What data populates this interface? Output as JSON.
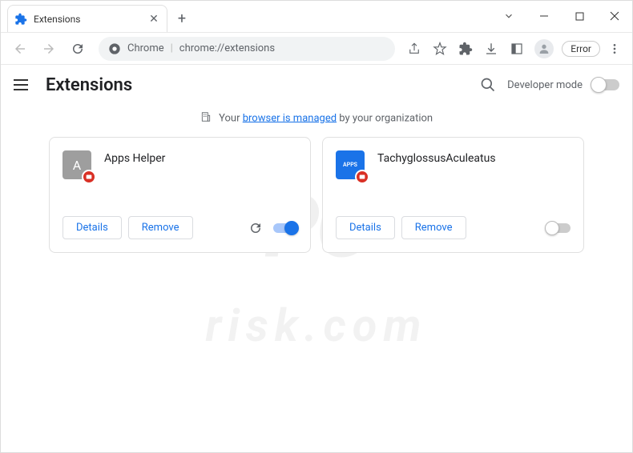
{
  "tab": {
    "title": "Extensions"
  },
  "omnibox": {
    "context": "Chrome",
    "url": "chrome://extensions"
  },
  "error_label": "Error",
  "page": {
    "title": "Extensions",
    "dev_mode": "Developer mode"
  },
  "managed": {
    "pre": "Your ",
    "link": "browser is managed",
    "post": " by your organization"
  },
  "buttons": {
    "details": "Details",
    "remove": "Remove"
  },
  "extensions": [
    {
      "name": "Apps Helper",
      "letter": "A",
      "enabled": true,
      "icon": "gray"
    },
    {
      "name": "TachyglossusAculeatus",
      "letter": "APPS",
      "enabled": false,
      "icon": "blue"
    }
  ],
  "watermark": {
    "main": "PC",
    "sub": "risk.com"
  }
}
